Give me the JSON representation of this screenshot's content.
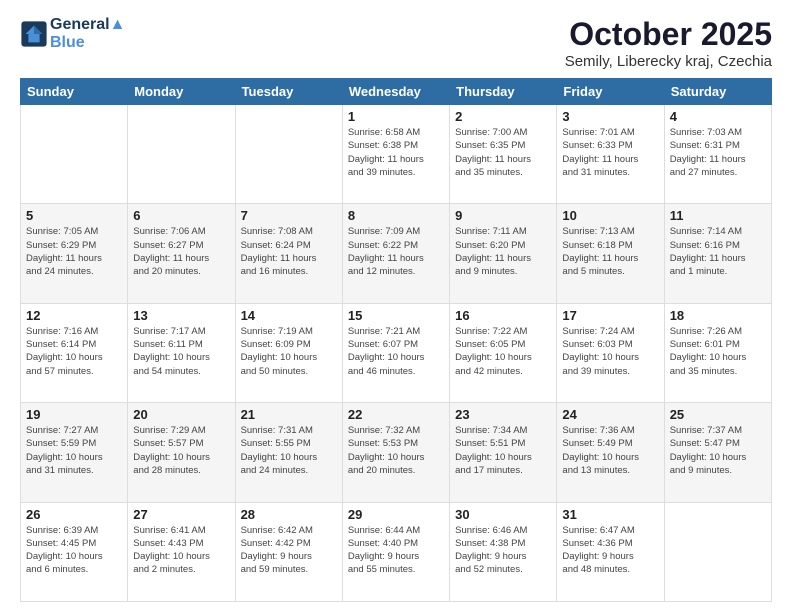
{
  "header": {
    "logo_line1": "General",
    "logo_line2": "Blue",
    "title": "October 2025",
    "subtitle": "Semily, Liberecky kraj, Czechia"
  },
  "calendar": {
    "days_of_week": [
      "Sunday",
      "Monday",
      "Tuesday",
      "Wednesday",
      "Thursday",
      "Friday",
      "Saturday"
    ],
    "weeks": [
      {
        "days": [
          {
            "number": "",
            "info": ""
          },
          {
            "number": "",
            "info": ""
          },
          {
            "number": "",
            "info": ""
          },
          {
            "number": "1",
            "info": "Sunrise: 6:58 AM\nSunset: 6:38 PM\nDaylight: 11 hours\nand 39 minutes."
          },
          {
            "number": "2",
            "info": "Sunrise: 7:00 AM\nSunset: 6:35 PM\nDaylight: 11 hours\nand 35 minutes."
          },
          {
            "number": "3",
            "info": "Sunrise: 7:01 AM\nSunset: 6:33 PM\nDaylight: 11 hours\nand 31 minutes."
          },
          {
            "number": "4",
            "info": "Sunrise: 7:03 AM\nSunset: 6:31 PM\nDaylight: 11 hours\nand 27 minutes."
          }
        ]
      },
      {
        "days": [
          {
            "number": "5",
            "info": "Sunrise: 7:05 AM\nSunset: 6:29 PM\nDaylight: 11 hours\nand 24 minutes."
          },
          {
            "number": "6",
            "info": "Sunrise: 7:06 AM\nSunset: 6:27 PM\nDaylight: 11 hours\nand 20 minutes."
          },
          {
            "number": "7",
            "info": "Sunrise: 7:08 AM\nSunset: 6:24 PM\nDaylight: 11 hours\nand 16 minutes."
          },
          {
            "number": "8",
            "info": "Sunrise: 7:09 AM\nSunset: 6:22 PM\nDaylight: 11 hours\nand 12 minutes."
          },
          {
            "number": "9",
            "info": "Sunrise: 7:11 AM\nSunset: 6:20 PM\nDaylight: 11 hours\nand 9 minutes."
          },
          {
            "number": "10",
            "info": "Sunrise: 7:13 AM\nSunset: 6:18 PM\nDaylight: 11 hours\nand 5 minutes."
          },
          {
            "number": "11",
            "info": "Sunrise: 7:14 AM\nSunset: 6:16 PM\nDaylight: 11 hours\nand 1 minute."
          }
        ]
      },
      {
        "days": [
          {
            "number": "12",
            "info": "Sunrise: 7:16 AM\nSunset: 6:14 PM\nDaylight: 10 hours\nand 57 minutes."
          },
          {
            "number": "13",
            "info": "Sunrise: 7:17 AM\nSunset: 6:11 PM\nDaylight: 10 hours\nand 54 minutes."
          },
          {
            "number": "14",
            "info": "Sunrise: 7:19 AM\nSunset: 6:09 PM\nDaylight: 10 hours\nand 50 minutes."
          },
          {
            "number": "15",
            "info": "Sunrise: 7:21 AM\nSunset: 6:07 PM\nDaylight: 10 hours\nand 46 minutes."
          },
          {
            "number": "16",
            "info": "Sunrise: 7:22 AM\nSunset: 6:05 PM\nDaylight: 10 hours\nand 42 minutes."
          },
          {
            "number": "17",
            "info": "Sunrise: 7:24 AM\nSunset: 6:03 PM\nDaylight: 10 hours\nand 39 minutes."
          },
          {
            "number": "18",
            "info": "Sunrise: 7:26 AM\nSunset: 6:01 PM\nDaylight: 10 hours\nand 35 minutes."
          }
        ]
      },
      {
        "days": [
          {
            "number": "19",
            "info": "Sunrise: 7:27 AM\nSunset: 5:59 PM\nDaylight: 10 hours\nand 31 minutes."
          },
          {
            "number": "20",
            "info": "Sunrise: 7:29 AM\nSunset: 5:57 PM\nDaylight: 10 hours\nand 28 minutes."
          },
          {
            "number": "21",
            "info": "Sunrise: 7:31 AM\nSunset: 5:55 PM\nDaylight: 10 hours\nand 24 minutes."
          },
          {
            "number": "22",
            "info": "Sunrise: 7:32 AM\nSunset: 5:53 PM\nDaylight: 10 hours\nand 20 minutes."
          },
          {
            "number": "23",
            "info": "Sunrise: 7:34 AM\nSunset: 5:51 PM\nDaylight: 10 hours\nand 17 minutes."
          },
          {
            "number": "24",
            "info": "Sunrise: 7:36 AM\nSunset: 5:49 PM\nDaylight: 10 hours\nand 13 minutes."
          },
          {
            "number": "25",
            "info": "Sunrise: 7:37 AM\nSunset: 5:47 PM\nDaylight: 10 hours\nand 9 minutes."
          }
        ]
      },
      {
        "days": [
          {
            "number": "26",
            "info": "Sunrise: 6:39 AM\nSunset: 4:45 PM\nDaylight: 10 hours\nand 6 minutes."
          },
          {
            "number": "27",
            "info": "Sunrise: 6:41 AM\nSunset: 4:43 PM\nDaylight: 10 hours\nand 2 minutes."
          },
          {
            "number": "28",
            "info": "Sunrise: 6:42 AM\nSunset: 4:42 PM\nDaylight: 9 hours\nand 59 minutes."
          },
          {
            "number": "29",
            "info": "Sunrise: 6:44 AM\nSunset: 4:40 PM\nDaylight: 9 hours\nand 55 minutes."
          },
          {
            "number": "30",
            "info": "Sunrise: 6:46 AM\nSunset: 4:38 PM\nDaylight: 9 hours\nand 52 minutes."
          },
          {
            "number": "31",
            "info": "Sunrise: 6:47 AM\nSunset: 4:36 PM\nDaylight: 9 hours\nand 48 minutes."
          },
          {
            "number": "",
            "info": ""
          }
        ]
      }
    ]
  }
}
